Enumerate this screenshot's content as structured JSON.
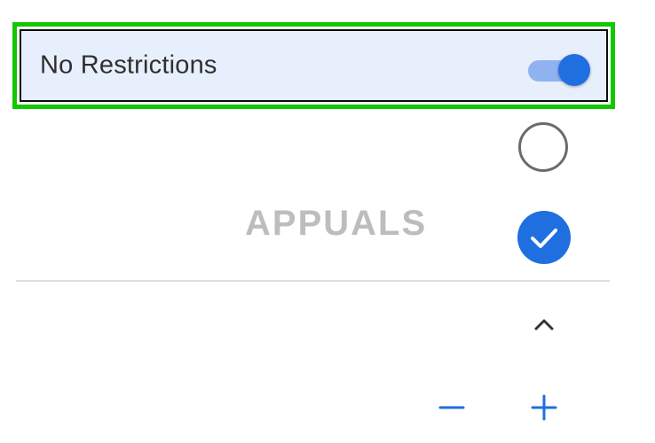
{
  "restrictions": {
    "label": "No Restrictions",
    "toggle_state": "on"
  },
  "watermark": {
    "text": "APPUALS"
  },
  "colors": {
    "accent": "#1f6fe0",
    "highlight_border": "#12c700",
    "row_background": "#e8effc"
  },
  "icons": {
    "toggle": "toggle-switch-on",
    "radio_empty": "radio-unchecked-icon",
    "radio_checked": "checkmark-circle-icon",
    "chevron": "chevron-up-icon",
    "minus": "minus-icon",
    "plus": "plus-icon"
  }
}
